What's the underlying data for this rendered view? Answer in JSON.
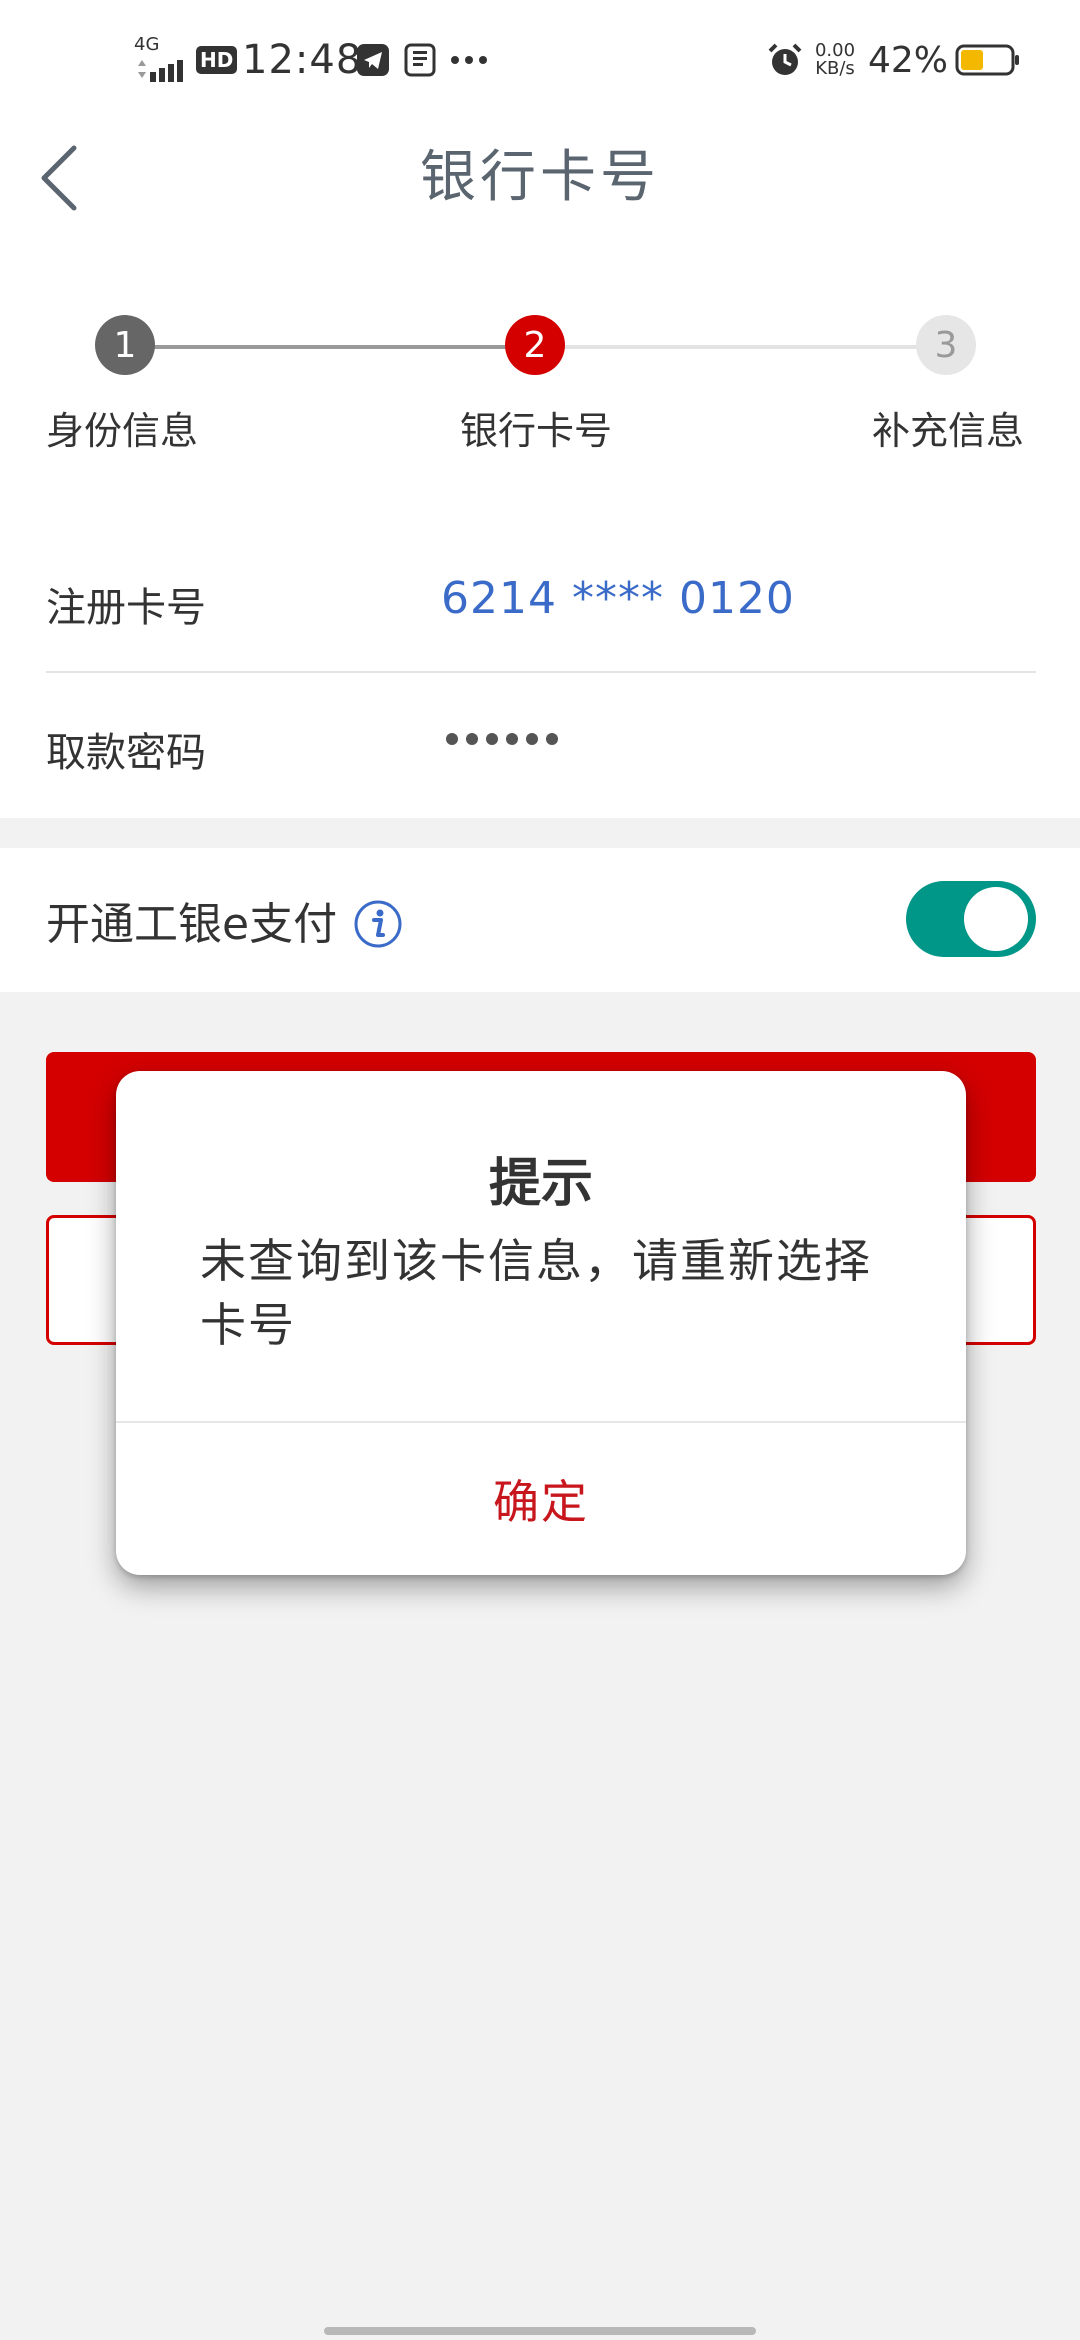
{
  "status_bar": {
    "network": "4G",
    "hd": "HD",
    "time": "12:48",
    "speed_value": "0.00",
    "speed_unit": "KB/s",
    "battery": "42%"
  },
  "header": {
    "title": "银行卡号"
  },
  "stepper": {
    "steps": [
      {
        "number": "1",
        "label": "身份信息"
      },
      {
        "number": "2",
        "label": "银行卡号"
      },
      {
        "number": "3",
        "label": "补充信息"
      }
    ],
    "current_step": 2
  },
  "form": {
    "card_label": "注册卡号",
    "card_value": "6214 **** 0120",
    "password_label": "取款密码",
    "password_length": 6
  },
  "epay": {
    "label": "开通工银e支付",
    "enabled": true
  },
  "dialog": {
    "title": "提示",
    "message": "未查询到该卡信息，请重新选择卡号",
    "confirm": "确定"
  },
  "colors": {
    "brand_red": "#d40000",
    "link_blue": "#3b6bc8",
    "toggle_on": "#009688"
  }
}
